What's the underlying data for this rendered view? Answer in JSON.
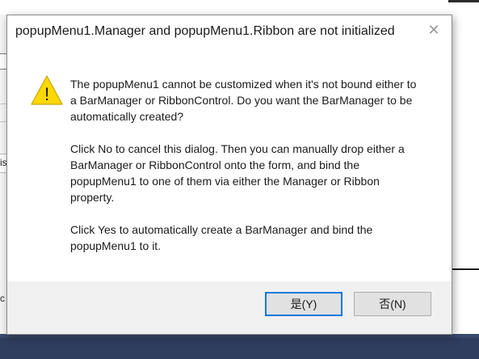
{
  "background": {
    "left_text_1": "is",
    "left_text_2": "c"
  },
  "dialog": {
    "title": "popupMenu1.Manager and popupMenu1.Ribbon are not initialized",
    "close_icon": "close-icon",
    "warning_icon": "warning-icon",
    "warning_glyph": "!",
    "message": [
      "The popupMenu1 cannot be customized when it's not bound either to a BarManager or RibbonControl. Do you want the BarManager to be automatically created?",
      "Click No to cancel this dialog. Then you can manually drop either a BarManager or RibbonControl onto the form, and bind the popupMenu1 to one of them via either the Manager or Ribbon property.",
      "Click Yes to automatically create a BarManager and bind the popupMenu1 to it."
    ],
    "buttons": {
      "yes_label": "是(Y)",
      "no_label": "否(N)"
    }
  },
  "colors": {
    "accent": "#0078d7",
    "warning_fill": "#ffd800",
    "taskbar": "#3a4a6b"
  }
}
